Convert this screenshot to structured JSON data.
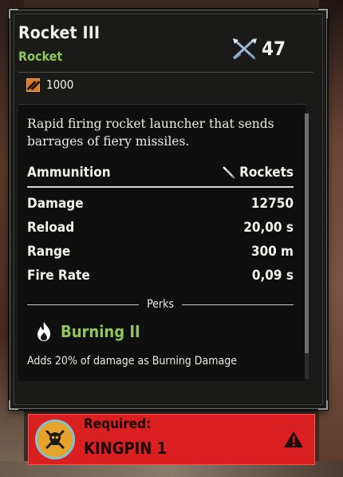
{
  "item": {
    "name": "Rocket III",
    "type": "Rocket",
    "power": "47",
    "cost": "1000",
    "description": "Rapid firing rocket launcher that sends barrages of fiery missiles."
  },
  "stats": {
    "ammunition_label": "Ammunition",
    "ammunition_value": "Rockets",
    "damage_label": "Damage",
    "damage_value": "12750",
    "reload_label": "Reload",
    "reload_value": "20,00 s",
    "range_label": "Range",
    "range_value": "300 m",
    "fire_rate_label": "Fire Rate",
    "fire_rate_value": "0,09 s"
  },
  "perks": {
    "section_label": "Perks",
    "items": [
      {
        "name": "Burning II",
        "description": "Adds 20% of damage as Burning Damage",
        "icon": "flame-icon"
      }
    ]
  },
  "requirement": {
    "label": "Required:",
    "value": "KINGPIN 1",
    "badge_icon": "skull-badge-icon",
    "warning_icon": "warning-icon"
  },
  "colors": {
    "accent_green": "#8fc55a",
    "required_red": "#d91f1f",
    "panel_bg": "#1a1a19"
  }
}
